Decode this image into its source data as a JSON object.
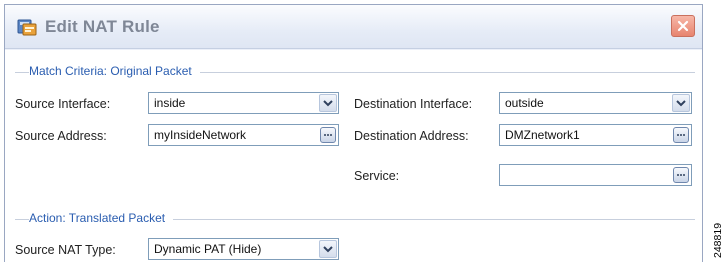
{
  "dialog": {
    "title": "Edit NAT Rule",
    "icons": {
      "app": "nat-rule-icon",
      "close": "close-icon"
    },
    "colors": {
      "title_text": "#7f8796",
      "section_title": "#2a5db0",
      "close_button": "#e7846f",
      "field_border": "#7f9db9"
    }
  },
  "match_criteria": {
    "title": "Match Criteria: Original Packet",
    "source_interface": {
      "label": "Source Interface:",
      "value": "inside",
      "control": "dropdown"
    },
    "destination_interface": {
      "label": "Destination Interface:",
      "value": "outside",
      "control": "dropdown"
    },
    "source_address": {
      "label": "Source Address:",
      "value": "myInsideNetwork",
      "control": "browse"
    },
    "destination_address": {
      "label": "Destination Address:",
      "value": "DMZnetwork1",
      "control": "browse"
    },
    "service": {
      "label": "Service:",
      "value": "",
      "control": "browse"
    }
  },
  "action": {
    "title": "Action: Translated Packet",
    "source_nat_type": {
      "label": "Source NAT Type:",
      "value": "Dynamic PAT (Hide)",
      "control": "dropdown"
    }
  },
  "figure_id": "248819"
}
